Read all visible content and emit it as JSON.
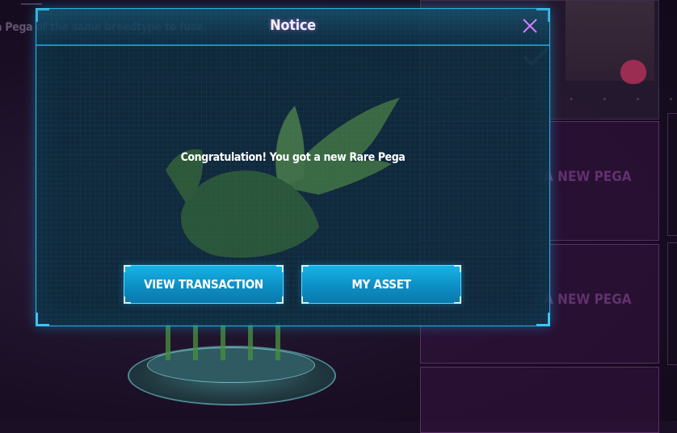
{
  "background": {
    "hint_text": "a Pega of the same breedtype to fuse.",
    "card_ghost_label": "A NEW PEGA",
    "colors": {
      "card_border": "#5b2e66",
      "page_bg": "#1a0f24"
    }
  },
  "modal": {
    "title": "Notice",
    "message": "Congratulation! You got a new Rare Pega",
    "buttons": {
      "view_transaction": "VIEW TRANSACTION",
      "my_asset": "MY ASSET"
    },
    "icons": {
      "close": "close-icon"
    },
    "colors": {
      "border": "#2ab3e0",
      "button": "#0d8fc4",
      "title_glow": "#c878ff",
      "close": "#d27cff"
    }
  }
}
